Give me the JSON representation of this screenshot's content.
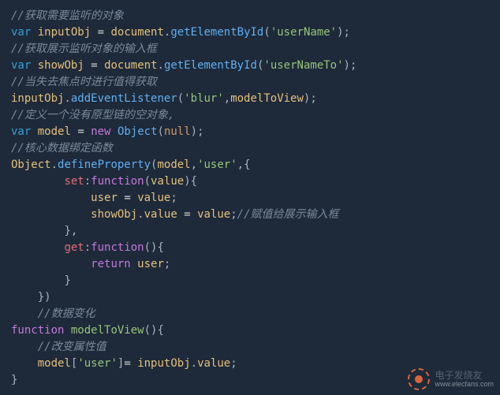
{
  "code": {
    "lines": [
      {
        "t": "comment",
        "text": "//获取需要监听的对象"
      },
      {
        "t": "code",
        "tokens": [
          {
            "c": "kw",
            "v": "var"
          },
          {
            "c": "pl",
            "v": " "
          },
          {
            "c": "id",
            "v": "inputObj"
          },
          {
            "c": "pl",
            "v": " "
          },
          {
            "c": "op",
            "v": "="
          },
          {
            "c": "pl",
            "v": " "
          },
          {
            "c": "id",
            "v": "document"
          },
          {
            "c": "pl",
            "v": "."
          },
          {
            "c": "fn",
            "v": "getElementById"
          },
          {
            "c": "pl",
            "v": "("
          },
          {
            "c": "str",
            "v": "'userName'"
          },
          {
            "c": "pl",
            "v": ");"
          }
        ]
      },
      {
        "t": "comment",
        "text": "//获取展示监听对象的输入框"
      },
      {
        "t": "code",
        "tokens": [
          {
            "c": "kw",
            "v": "var"
          },
          {
            "c": "pl",
            "v": " "
          },
          {
            "c": "id",
            "v": "showObj"
          },
          {
            "c": "pl",
            "v": " "
          },
          {
            "c": "op",
            "v": "="
          },
          {
            "c": "pl",
            "v": " "
          },
          {
            "c": "id",
            "v": "document"
          },
          {
            "c": "pl",
            "v": "."
          },
          {
            "c": "fn",
            "v": "getElementById"
          },
          {
            "c": "pl",
            "v": "("
          },
          {
            "c": "str",
            "v": "'userNameTo'"
          },
          {
            "c": "pl",
            "v": ");"
          }
        ]
      },
      {
        "t": "comment",
        "text": "//当失去焦点时进行值得获取"
      },
      {
        "t": "code",
        "tokens": [
          {
            "c": "id",
            "v": "inputObj"
          },
          {
            "c": "pl",
            "v": "."
          },
          {
            "c": "fn",
            "v": "addEventListener"
          },
          {
            "c": "pl",
            "v": "("
          },
          {
            "c": "str",
            "v": "'blur'"
          },
          {
            "c": "pl",
            "v": ","
          },
          {
            "c": "id",
            "v": "modelToView"
          },
          {
            "c": "pl",
            "v": ");"
          }
        ]
      },
      {
        "t": "comment",
        "text": "//定义一个没有原型链的空对象,"
      },
      {
        "t": "code",
        "tokens": [
          {
            "c": "kw",
            "v": "var"
          },
          {
            "c": "pl",
            "v": " "
          },
          {
            "c": "id",
            "v": "model"
          },
          {
            "c": "pl",
            "v": " "
          },
          {
            "c": "op",
            "v": "="
          },
          {
            "c": "pl",
            "v": " "
          },
          {
            "c": "kw2",
            "v": "new"
          },
          {
            "c": "pl",
            "v": " "
          },
          {
            "c": "fn",
            "v": "Object"
          },
          {
            "c": "pl",
            "v": "("
          },
          {
            "c": "num",
            "v": "null"
          },
          {
            "c": "pl",
            "v": ");"
          }
        ]
      },
      {
        "t": "comment",
        "text": "//核心数据绑定函数"
      },
      {
        "t": "code",
        "tokens": [
          {
            "c": "id",
            "v": "Object"
          },
          {
            "c": "pl",
            "v": "."
          },
          {
            "c": "fn",
            "v": "defineProperty"
          },
          {
            "c": "pl",
            "v": "("
          },
          {
            "c": "id",
            "v": "model"
          },
          {
            "c": "pl",
            "v": ","
          },
          {
            "c": "str",
            "v": "'user'"
          },
          {
            "c": "pl",
            "v": ",{"
          }
        ]
      },
      {
        "t": "code",
        "indent": 2,
        "tokens": [
          {
            "c": "prop",
            "v": "set"
          },
          {
            "c": "pl",
            "v": ":"
          },
          {
            "c": "kw2",
            "v": "function"
          },
          {
            "c": "pl",
            "v": "("
          },
          {
            "c": "id",
            "v": "value"
          },
          {
            "c": "pl",
            "v": "){"
          }
        ]
      },
      {
        "t": "code",
        "indent": 3,
        "tokens": [
          {
            "c": "id",
            "v": "user"
          },
          {
            "c": "pl",
            "v": " "
          },
          {
            "c": "op",
            "v": "="
          },
          {
            "c": "pl",
            "v": " "
          },
          {
            "c": "id",
            "v": "value"
          },
          {
            "c": "pl",
            "v": ";"
          }
        ]
      },
      {
        "t": "code",
        "indent": 3,
        "tokens": [
          {
            "c": "id",
            "v": "showObj"
          },
          {
            "c": "pl",
            "v": "."
          },
          {
            "c": "id",
            "v": "value"
          },
          {
            "c": "pl",
            "v": " "
          },
          {
            "c": "op",
            "v": "="
          },
          {
            "c": "pl",
            "v": " "
          },
          {
            "c": "id",
            "v": "value"
          },
          {
            "c": "pl",
            "v": ";"
          },
          {
            "c": "cm",
            "v": "//赋值给展示输入框"
          }
        ]
      },
      {
        "t": "code",
        "indent": 2,
        "tokens": [
          {
            "c": "pl",
            "v": "},"
          }
        ]
      },
      {
        "t": "code",
        "indent": 2,
        "tokens": [
          {
            "c": "prop",
            "v": "get"
          },
          {
            "c": "pl",
            "v": ":"
          },
          {
            "c": "kw2",
            "v": "function"
          },
          {
            "c": "pl",
            "v": "(){"
          }
        ]
      },
      {
        "t": "code",
        "indent": 3,
        "tokens": [
          {
            "c": "kw2",
            "v": "return"
          },
          {
            "c": "pl",
            "v": " "
          },
          {
            "c": "id",
            "v": "user"
          },
          {
            "c": "pl",
            "v": ";"
          }
        ]
      },
      {
        "t": "code",
        "indent": 2,
        "tokens": [
          {
            "c": "pl",
            "v": "}"
          }
        ]
      },
      {
        "t": "code",
        "indent": 1,
        "tokens": [
          {
            "c": "pl",
            "v": "})"
          }
        ]
      },
      {
        "t": "comment",
        "indent": 1,
        "text": "//数据变化"
      },
      {
        "t": "code",
        "tokens": [
          {
            "c": "kw2",
            "v": "function"
          },
          {
            "c": "pl",
            "v": " "
          },
          {
            "c": "fn2",
            "v": "modelToView"
          },
          {
            "c": "pl",
            "v": "(){"
          }
        ]
      },
      {
        "t": "comment",
        "indent": 1,
        "text": "//改变属性值"
      },
      {
        "t": "code",
        "indent": 1,
        "tokens": [
          {
            "c": "id",
            "v": "model"
          },
          {
            "c": "pl",
            "v": "["
          },
          {
            "c": "str",
            "v": "'user'"
          },
          {
            "c": "pl",
            "v": "]"
          },
          {
            "c": "op",
            "v": "="
          },
          {
            "c": "pl",
            "v": " "
          },
          {
            "c": "id",
            "v": "inputObj"
          },
          {
            "c": "pl",
            "v": "."
          },
          {
            "c": "id",
            "v": "value"
          },
          {
            "c": "pl",
            "v": ";"
          }
        ]
      },
      {
        "t": "code",
        "tokens": [
          {
            "c": "pl",
            "v": "}"
          }
        ]
      }
    ]
  },
  "watermark": {
    "line1": "电子发烧友",
    "line2": "www.elecfans.com"
  }
}
